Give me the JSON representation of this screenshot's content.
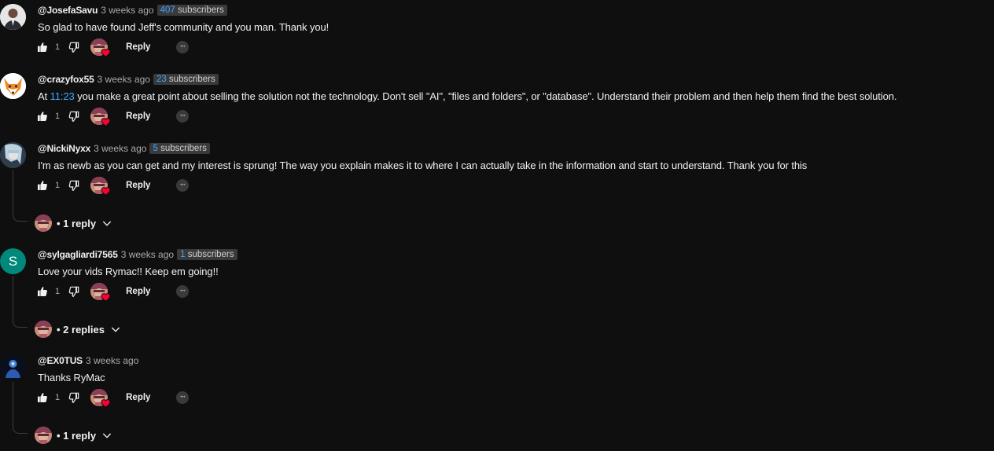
{
  "comments": [
    {
      "author": "@JosefaSavu",
      "time": "3 weeks ago",
      "subs_num": "407",
      "subs_label": " subscribers",
      "text": "So glad to have found Jeff's community and you man. Thank you!",
      "likes": "1",
      "reply_label": "Reply",
      "avatar_icon": "person-in-suit-icon"
    },
    {
      "author": "@crazyfox55",
      "time": "3 weeks ago",
      "subs_num": "23",
      "subs_label": " subscribers",
      "text_pre": "At ",
      "timestamp_link": "11:23",
      "text_post": " you make a great point about selling the solution not the technology. Don't sell \"AI\", \"files and folders\", or \"database\". Understand their problem and then help them find the best solution.",
      "likes": "1",
      "reply_label": "Reply",
      "avatar_icon": "fox-icon"
    },
    {
      "author": "@NickiNyxx",
      "time": "3 weeks ago",
      "subs_num": "5",
      "subs_label": " subscribers",
      "text": "I'm as newb as you can get and my interest is sprung! The way you explain makes it to where I can actually take in the information and start to understand. Thank you for this",
      "likes": "1",
      "reply_label": "Reply",
      "replies_label": "• 1 reply",
      "avatar_icon": "anime-character-icon"
    },
    {
      "author": "@sylgagliardi7565",
      "time": "3 weeks ago",
      "subs_num": "1",
      "subs_label": " subscribers",
      "text": "Love your vids Rymac!! Keep em going!!",
      "likes": "1",
      "reply_label": "Reply",
      "replies_label": "• 2 replies",
      "avatar_letter": "S",
      "avatar_color": "#00897b"
    },
    {
      "author": "@EX0TUS",
      "time": "3 weeks ago",
      "text": "Thanks RyMac",
      "likes": "1",
      "reply_label": "Reply",
      "replies_label": "• 1 reply",
      "avatar_icon": "blue-figure-icon"
    }
  ],
  "colors": {
    "background": "#0f0f0f",
    "link": "#3ea6ff",
    "heart": "#ff0033",
    "badge_bg": "#3a3a3a"
  }
}
